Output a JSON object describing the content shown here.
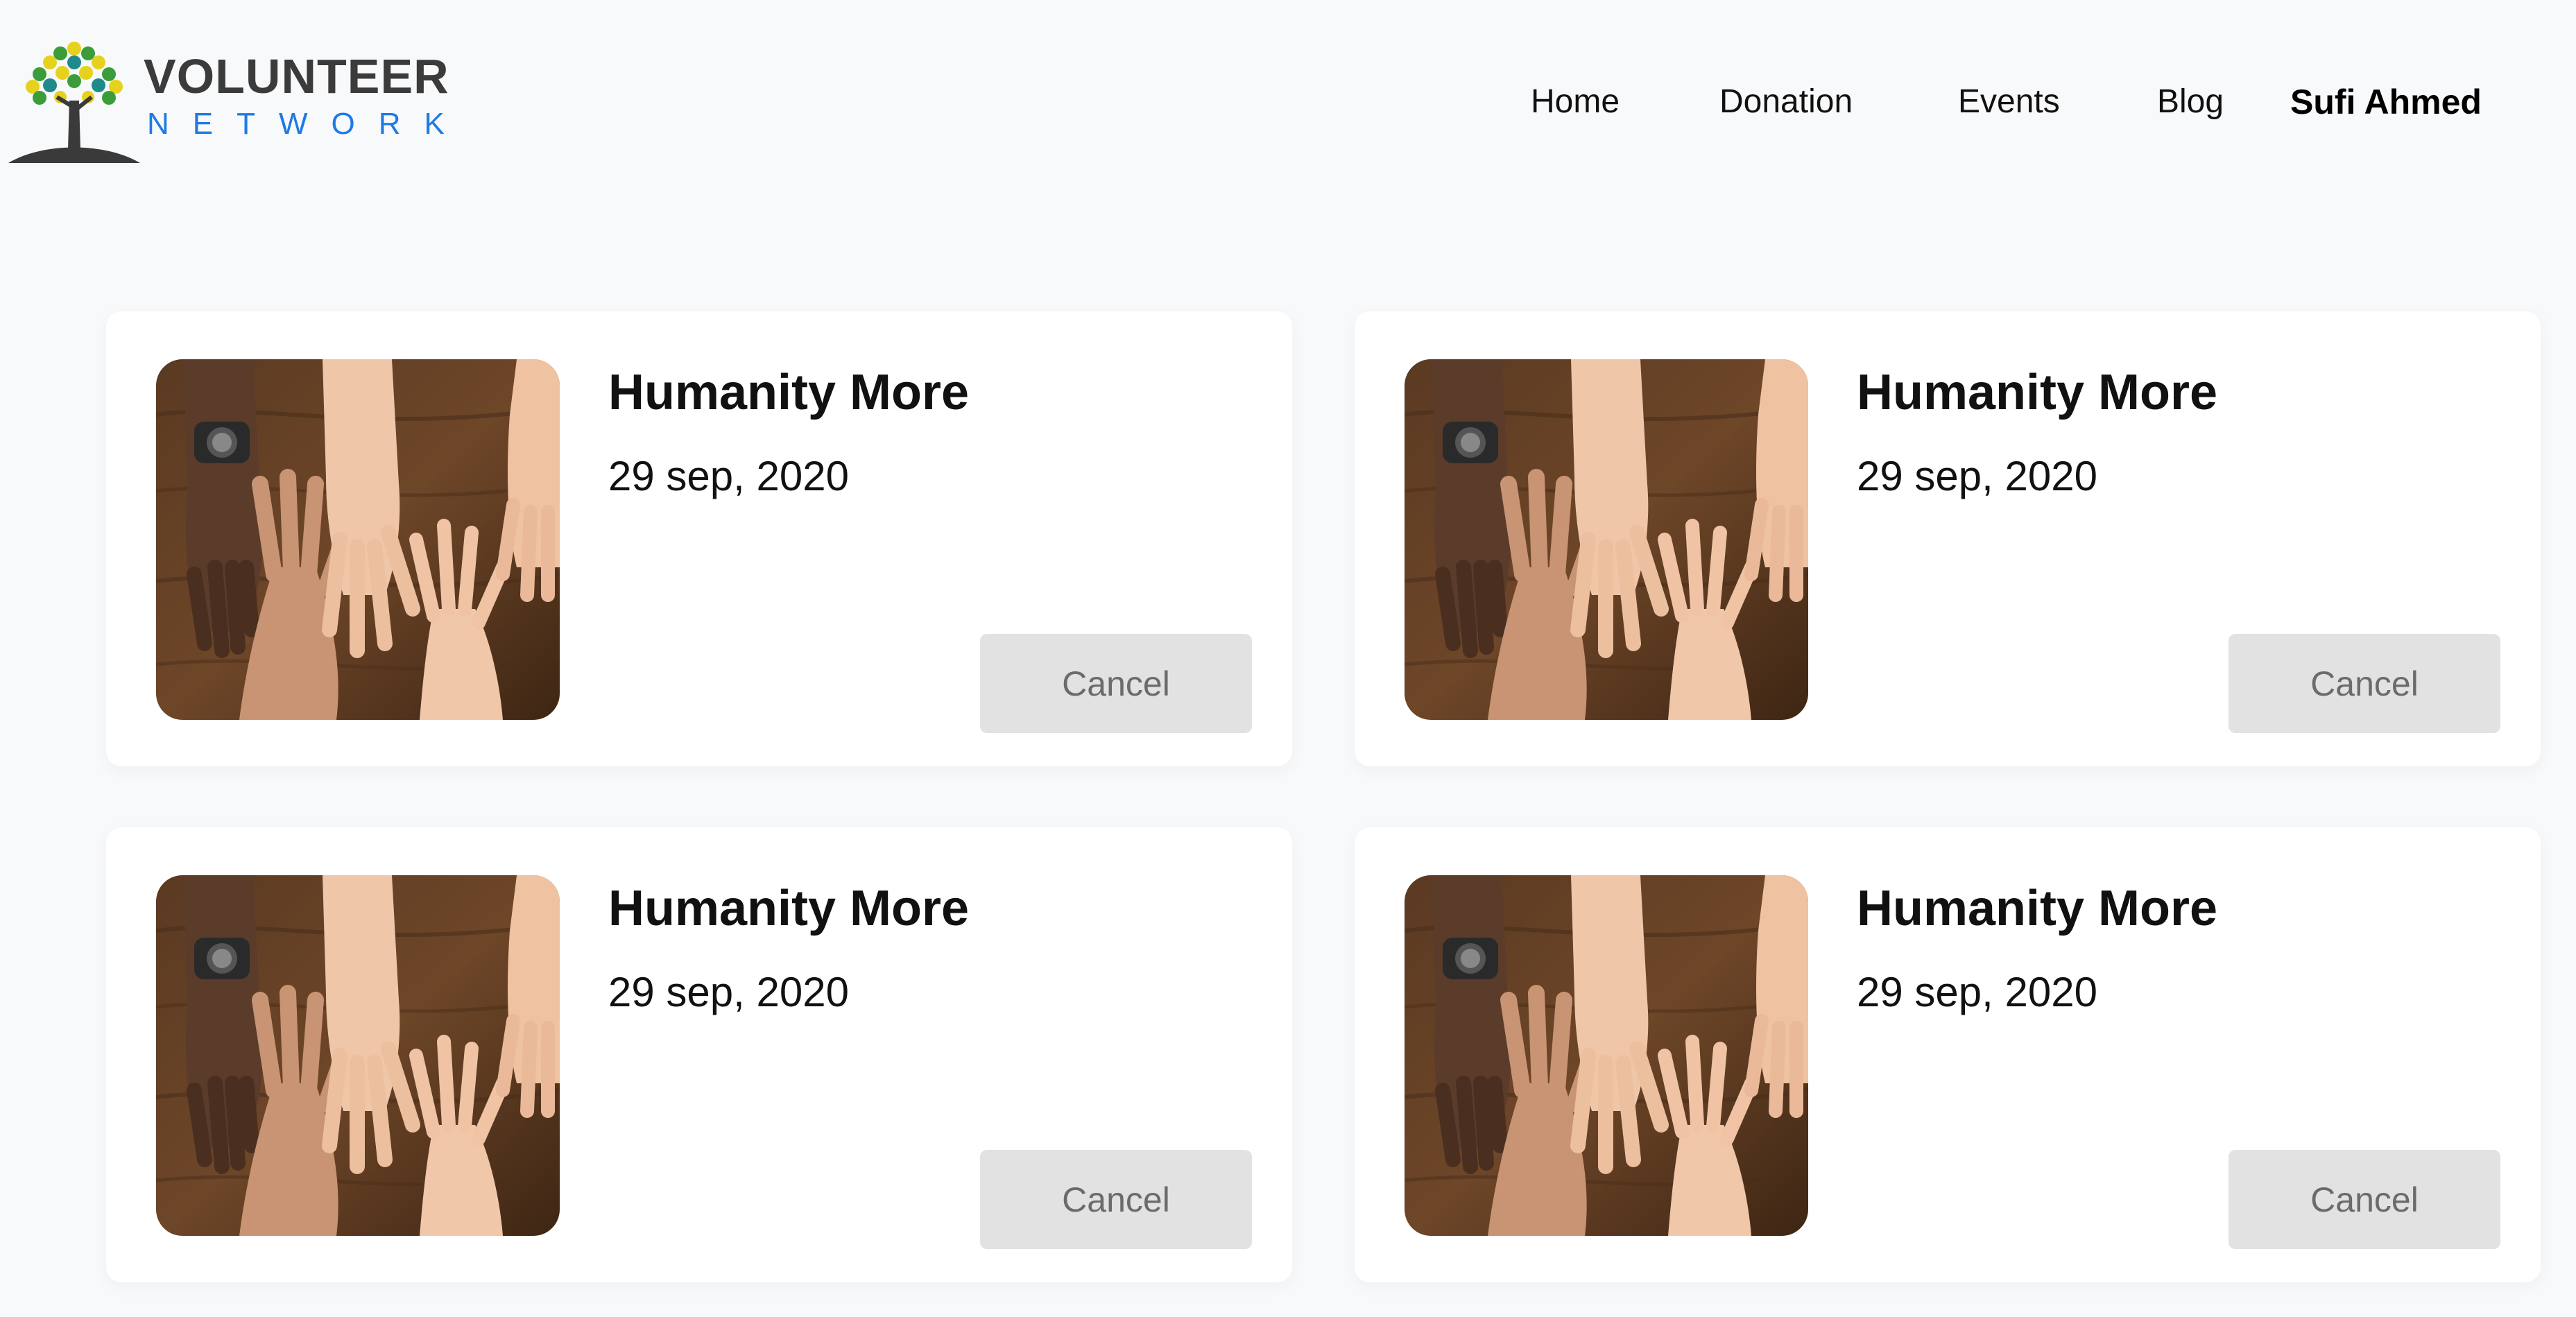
{
  "brand": {
    "title": "VOLUNTEER",
    "subtitle": "NETWORK",
    "colors": {
      "title": "#3b3b3b",
      "subtitle": "#1e7ae6",
      "leaf_green": "#3a9d3a",
      "leaf_yellow": "#e6d21c",
      "leaf_teal": "#1f8a8a"
    }
  },
  "nav": {
    "items": [
      {
        "label": "Home"
      },
      {
        "label": "Donation"
      },
      {
        "label": "Events"
      },
      {
        "label": "Blog"
      }
    ],
    "user_name": "Sufi Ahmed"
  },
  "events": [
    {
      "title": "Humanity More",
      "date": "29 sep, 2020",
      "action": "Cancel",
      "image_icon": "hands-on-table-photo"
    },
    {
      "title": "Humanity More",
      "date": "29 sep, 2020",
      "action": "Cancel",
      "image_icon": "hands-on-table-photo"
    },
    {
      "title": "Humanity More",
      "date": "29 sep, 2020",
      "action": "Cancel",
      "image_icon": "hands-on-table-photo"
    },
    {
      "title": "Humanity More",
      "date": "29 sep, 2020",
      "action": "Cancel",
      "image_icon": "hands-on-table-photo"
    }
  ],
  "theme": {
    "background": "#f8f9fb",
    "card_background": "#ffffff",
    "button_background": "#e2e2e2",
    "button_text": "#6b6b6b"
  }
}
